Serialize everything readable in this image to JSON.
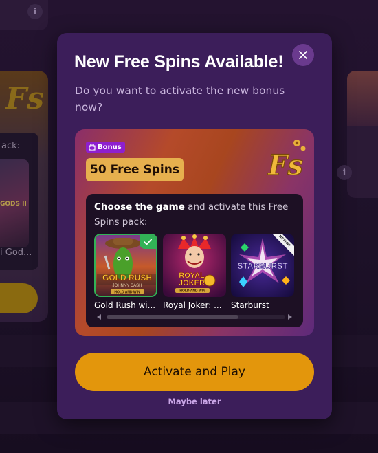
{
  "modal": {
    "title": "New Free Spins Available!",
    "subtitle": "Do you want to activate the new bonus now?",
    "close_icon": "close-icon"
  },
  "bonus": {
    "tag_label": "Bonus",
    "tag_icon": "gift-icon",
    "spins_label": "50 Free Spins",
    "logo_text": "Fs"
  },
  "game_picker": {
    "prompt_bold": "Choose the game",
    "prompt_rest": " and activate this Free Spins pack:",
    "games": [
      {
        "name": "Gold Rush wi...",
        "art_line1": "GOLD RUSH",
        "art_line2": "JOHNNY CASH",
        "art_line3": "HOLD AND WIN",
        "selected": true
      },
      {
        "name": "Royal Joker: ...",
        "art_line1": "ROYAL",
        "art_line2": "JOKER",
        "art_line3": "HOLD AND WIN",
        "selected": false
      },
      {
        "name": "Starburst",
        "art_line1": "STARBURST",
        "provider": "NETENT",
        "selected": false
      }
    ]
  },
  "actions": {
    "activate_label": "Activate and Play",
    "later_label": "Maybe later"
  },
  "background": {
    "left_pack_text": "ack:",
    "left_game_caption": "i God...",
    "left_art_text": "GODS II",
    "info_glyph": "i"
  },
  "colors": {
    "modal_bg": "#3c1e5a",
    "accent_orange": "#e3960c",
    "spins_pill": "#e6b04e",
    "bonus_tag": "#8e1fd0",
    "selected_green": "#32b256"
  }
}
